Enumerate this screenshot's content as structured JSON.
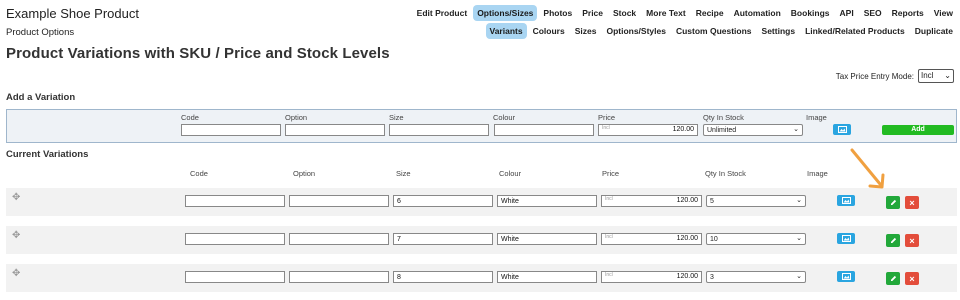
{
  "header": {
    "product_name": "Example Shoe Product",
    "section": "Product Options",
    "title": "Product Variations with SKU / Price and Stock Levels"
  },
  "nav_primary": [
    {
      "label": "Edit Product",
      "active": false
    },
    {
      "label": "Options/Sizes",
      "active": true
    },
    {
      "label": "Photos",
      "active": false
    },
    {
      "label": "Price",
      "active": false
    },
    {
      "label": "Stock",
      "active": false
    },
    {
      "label": "More Text",
      "active": false
    },
    {
      "label": "Recipe",
      "active": false
    },
    {
      "label": "Automation",
      "active": false
    },
    {
      "label": "Bookings",
      "active": false
    },
    {
      "label": "API",
      "active": false
    },
    {
      "label": "SEO",
      "active": false
    },
    {
      "label": "Reports",
      "active": false
    },
    {
      "label": "View",
      "active": false
    }
  ],
  "nav_secondary": [
    {
      "label": "Variants",
      "active": true
    },
    {
      "label": "Colours",
      "active": false
    },
    {
      "label": "Sizes",
      "active": false
    },
    {
      "label": "Options/Styles",
      "active": false
    },
    {
      "label": "Custom Questions",
      "active": false
    },
    {
      "label": "Settings",
      "active": false
    },
    {
      "label": "Linked/Related Products",
      "active": false
    },
    {
      "label": "Duplicate",
      "active": false
    }
  ],
  "tax_mode": {
    "label": "Tax Price Entry Mode:",
    "value": "Incl"
  },
  "add_variation": {
    "title": "Add a Variation",
    "columns": {
      "code": "Code",
      "option": "Option",
      "size": "Size",
      "colour": "Colour",
      "price": "Price",
      "qty": "Qty In Stock",
      "image": "Image"
    },
    "price_placeholder": "Incl",
    "price_value": "120.00",
    "qty_value": "Unlimited",
    "add_label": "Add"
  },
  "current": {
    "title": "Current Variations",
    "columns": {
      "code": "Code",
      "option": "Option",
      "size": "Size",
      "colour": "Colour",
      "price": "Price",
      "qty": "Qty In Stock",
      "image": "Image"
    },
    "rows": [
      {
        "code": "",
        "option": "",
        "size": "6",
        "colour": "White",
        "price_placeholder": "Incl",
        "price": "120.00",
        "qty": "5"
      },
      {
        "code": "",
        "option": "",
        "size": "7",
        "colour": "White",
        "price_placeholder": "Incl",
        "price": "120.00",
        "qty": "10"
      },
      {
        "code": "",
        "option": "",
        "size": "8",
        "colour": "White",
        "price_placeholder": "Incl",
        "price": "120.00",
        "qty": "3"
      }
    ]
  },
  "icons": {
    "move": "move-icon",
    "image": "image-icon",
    "edit": "pencil-icon",
    "delete": "close-icon",
    "annotation": "arrow-annotation"
  },
  "colors": {
    "active_tab": "#a9d5f2",
    "add_button": "#22bb22",
    "edit_button": "#22a83a",
    "delete_button": "#e34d3b",
    "image_button": "#2aa5e0",
    "arrow": "#f0a040"
  }
}
